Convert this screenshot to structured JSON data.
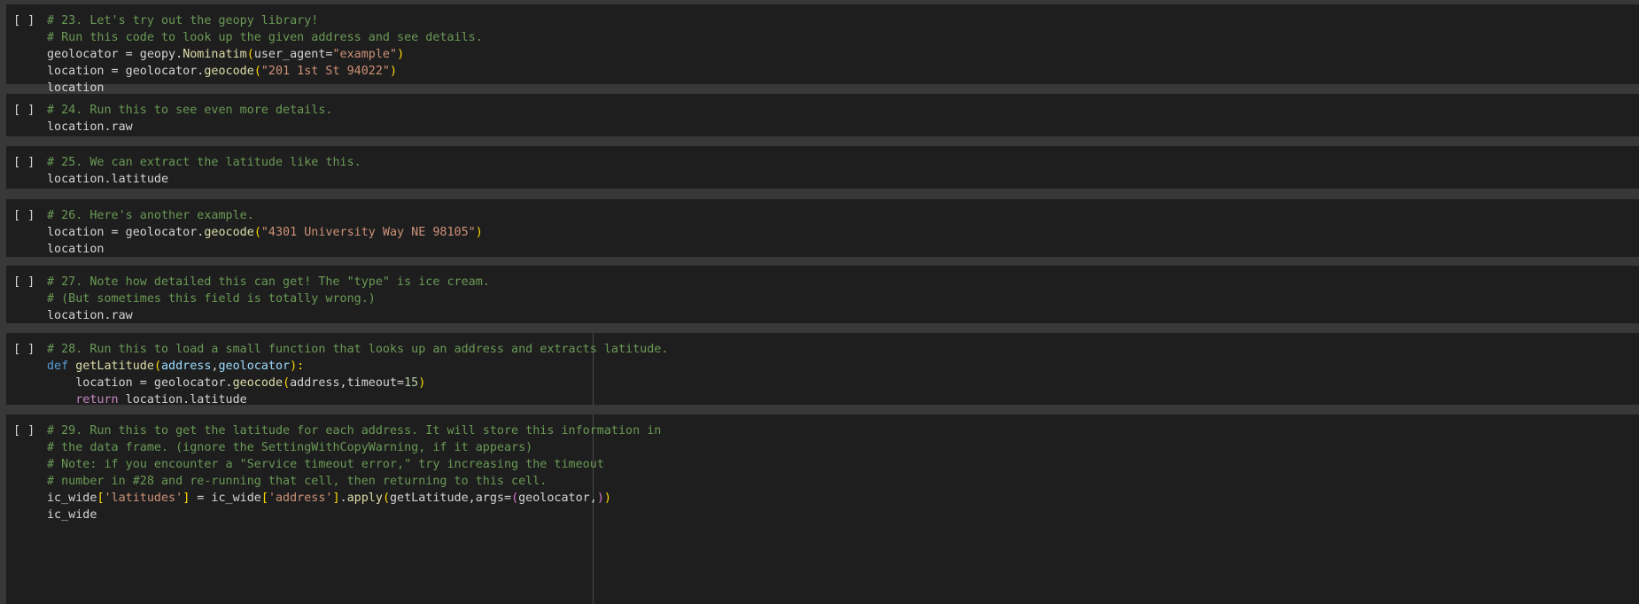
{
  "cells": [
    {
      "prompt": "[ ]",
      "lines": {
        "l1": "# 23. Let's try out the geopy library!",
        "l2": "# Run this code to look up the given address and see details.",
        "l3a": "geolocator = geopy.",
        "l3fn": "Nominatim",
        "l3b": "(",
        "l3c": "user_agent=",
        "l3s": "\"example\"",
        "l3d": ")",
        "l4a": "location = geolocator.",
        "l4fn": "geocode",
        "l4b": "(",
        "l4s": "\"201 1st St 94022\"",
        "l4c": ")",
        "l5": "location"
      }
    },
    {
      "prompt": "[ ]",
      "lines": {
        "l1": "# 24. Run this to see even more details.",
        "l2": "location.raw"
      }
    },
    {
      "prompt": "[ ]",
      "lines": {
        "l1": "# 25. We can extract the latitude like this.",
        "l2": "location.latitude"
      }
    },
    {
      "prompt": "[ ]",
      "lines": {
        "l1": "# 26. Here's another example.",
        "l2a": "location = geolocator.",
        "l2fn": "geocode",
        "l2b": "(",
        "l2s": "\"4301 University Way NE 98105\"",
        "l2c": ")",
        "l3": "location"
      }
    },
    {
      "prompt": "[ ]",
      "lines": {
        "l1": "# 27. Note how detailed this can get! The \"type\" is ice cream.",
        "l2": "# (But sometimes this field is totally wrong.)",
        "l3": "location.raw"
      }
    },
    {
      "prompt": "[ ]",
      "lines": {
        "l1": "# 28. Run this to load a small function that looks up an address and extracts latitude.",
        "l2kw": "def",
        "l2fn": "getLatitude",
        "l2b": "(",
        "l2p1": "address",
        "l2comma": ",",
        "l2p2": "geolocator",
        "l2c": "):",
        "l3a": "location = geolocator.",
        "l3fn": "geocode",
        "l3b": "(",
        "l3c": "address,timeout=",
        "l3n": "15",
        "l3d": ")",
        "l4kw": "return",
        "l4a": " location.latitude"
      }
    },
    {
      "prompt": "[ ]",
      "lines": {
        "l1": "# 29. Run this to get the latitude for each address. It will store this information in",
        "l2": "# the data frame. (ignore the SettingWithCopyWarning, if it appears)",
        "l3": "# Note: if you encounter a \"Service timeout error,\" try increasing the timeout",
        "l4": "# number in #28 and re-running that cell, then returning to this cell.",
        "l5a": "ic_wide",
        "l5b1": "[",
        "l5s1": "'latitudes'",
        "l5b2": "]",
        "l5eq": " = ic_wide",
        "l5b3": "[",
        "l5s2": "'address'",
        "l5b4": "]",
        "l5dot": ".",
        "l5fn": "apply",
        "l5p": "(",
        "l5c": "getLatitude,args=",
        "l5p2": "(",
        "l5d": "geolocator,",
        "l5p3": ")",
        "l5p4": ")",
        "l6": "ic_wide"
      }
    }
  ]
}
